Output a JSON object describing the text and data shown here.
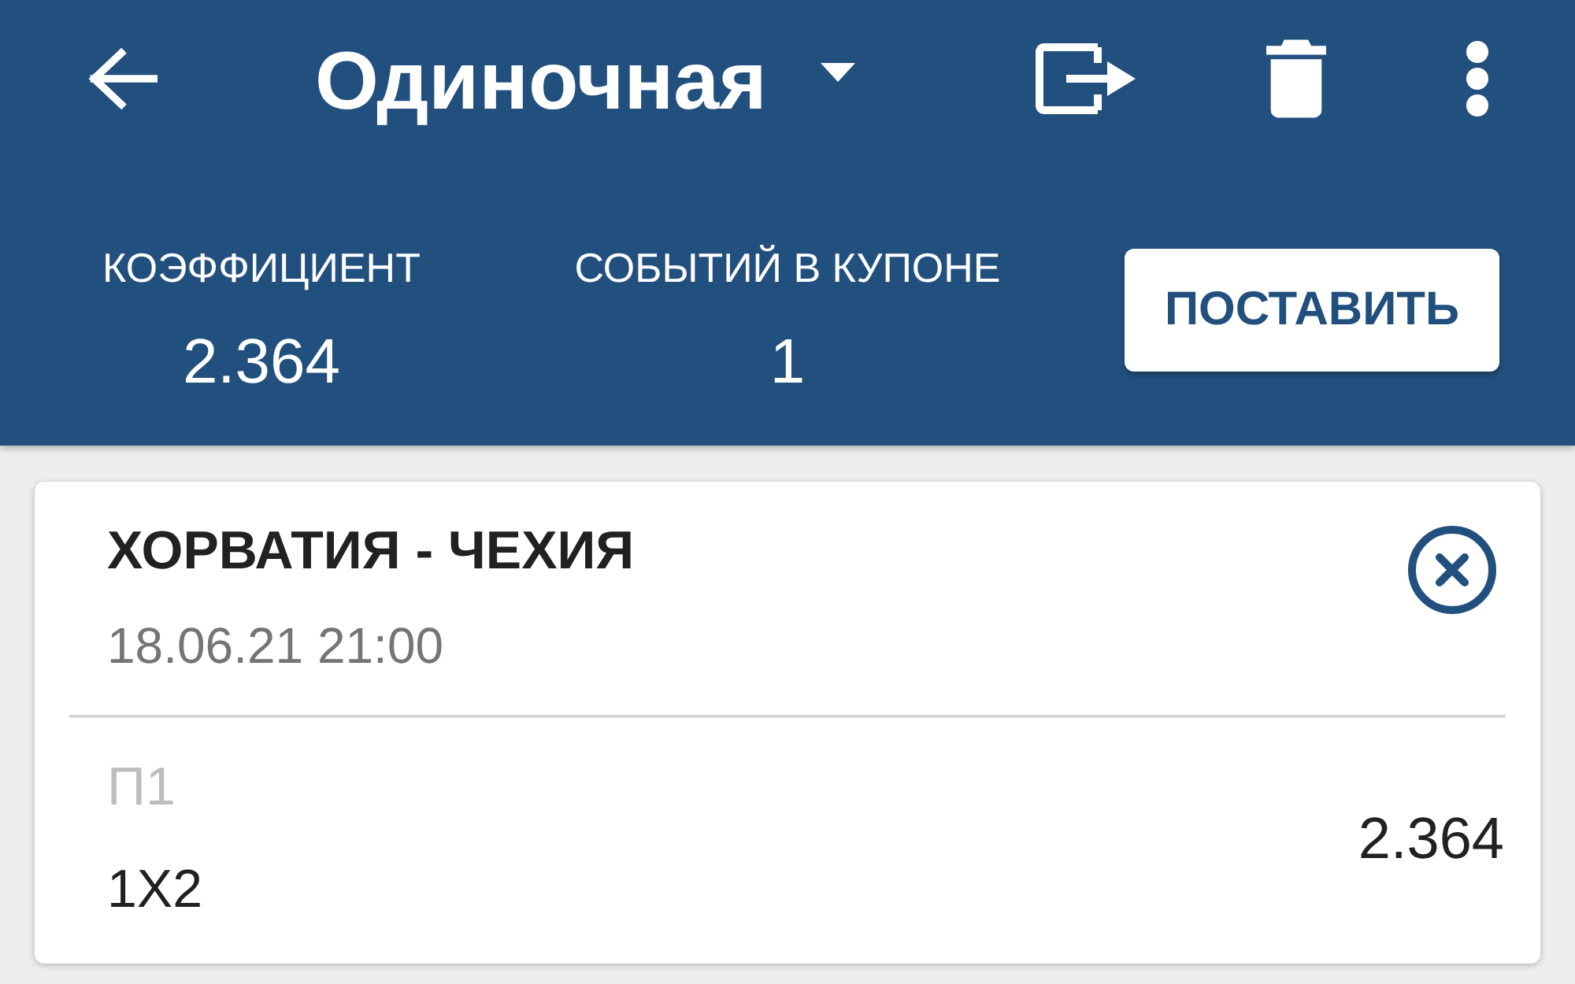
{
  "toolbar": {
    "title": "Одиночная"
  },
  "summary": [
    {
      "label": "КОЭФФИЦИЕНТ",
      "value": "2.364"
    },
    {
      "label": "СОБЫТИЙ В КУПОНЕ",
      "value": "1"
    }
  ],
  "place_bet_button": "ПОСТАВИТЬ",
  "bets": [
    {
      "match": "ХОРВАТИЯ - ЧЕХИЯ",
      "datetime": "18.06.21 21:00",
      "outcome": "П1",
      "market": "1X2",
      "odds": "2.364"
    }
  ]
}
